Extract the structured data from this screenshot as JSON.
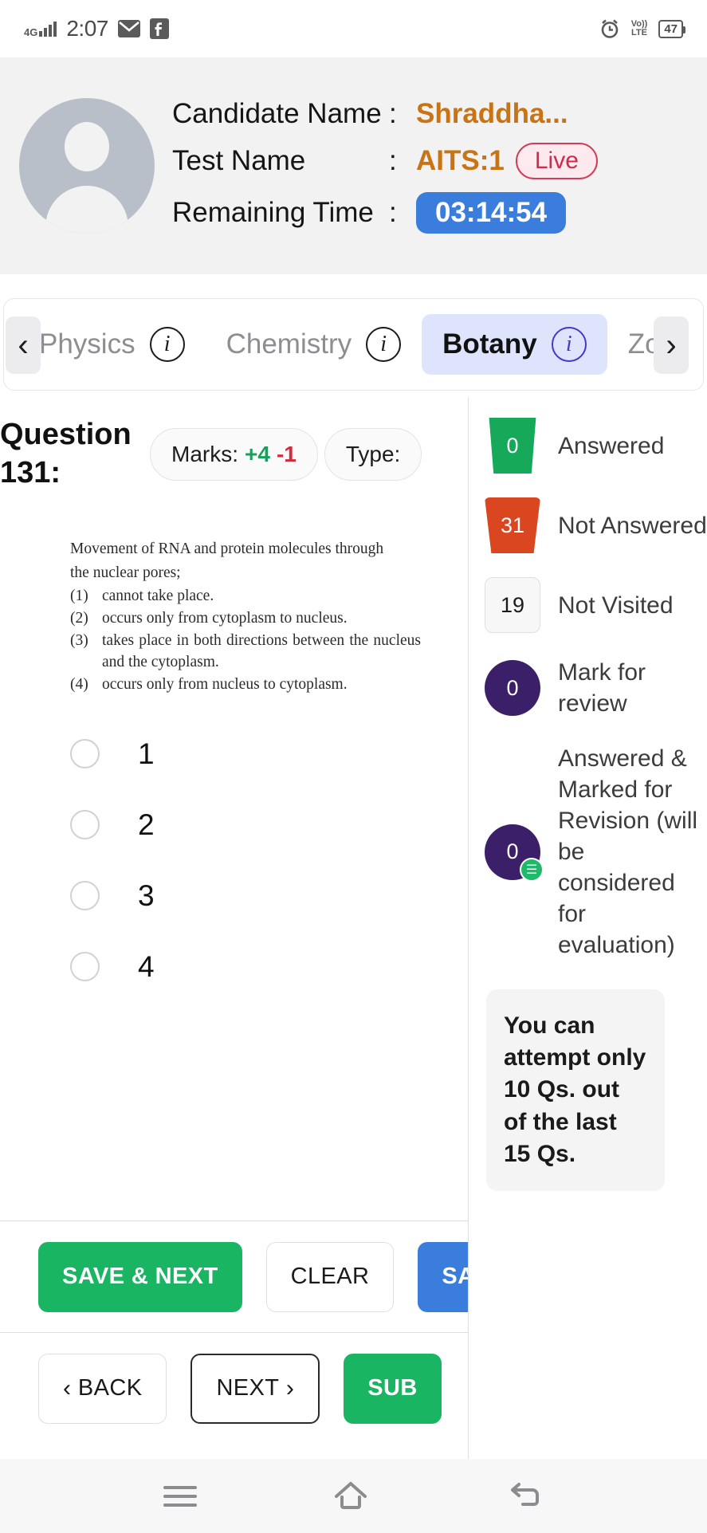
{
  "statusbar": {
    "network": "4G",
    "time": "2:07",
    "mail_icon": "mail-icon",
    "facebook_icon": "facebook-icon",
    "alarm_icon": "alarm-icon",
    "volte_line1": "Vo))",
    "volte_line2": "LTE",
    "battery": "47"
  },
  "header": {
    "rows": [
      {
        "label": "Candidate Name",
        "colon": ":",
        "value": "Shraddha..."
      },
      {
        "label": "Test Name",
        "colon": ":",
        "value": "AITS:1",
        "badge": "Live"
      },
      {
        "label": "Remaining Time",
        "colon": ":",
        "timer": "03:14:54"
      }
    ],
    "avatar": "user-avatar-placeholder",
    "accent_value": "#c87414",
    "live_color": "#d12a4b",
    "timer_bg": "#3b7ddd"
  },
  "tabs": {
    "left_arrow": "‹",
    "right_arrow": "›",
    "items": [
      {
        "label": "Physics",
        "info": "i",
        "active": false
      },
      {
        "label": "Chemistry",
        "info": "i",
        "active": false
      },
      {
        "label": "Botany",
        "info": "i",
        "active": true
      },
      {
        "label": "Zo",
        "info": "",
        "active": false
      }
    ],
    "active_bg": "#dde4fb"
  },
  "question": {
    "number_label": "Question 131:",
    "marks_chip_label": "Marks:",
    "marks_positive": "+4",
    "marks_negative": "-1",
    "type_chip_label": "Type:",
    "stem_line1": "Movement of RNA and protein molecules through",
    "stem_line2": "the nuclear pores;",
    "choices": [
      {
        "num": "(1)",
        "text": "cannot take place."
      },
      {
        "num": "(2)",
        "text": "occurs only from cytoplasm to nucleus."
      },
      {
        "num": "(3)",
        "text": "takes place in both directions between the nucleus and the cytoplasm."
      },
      {
        "num": "(4)",
        "text": "occurs only from nucleus to cytoplasm."
      }
    ],
    "options": [
      {
        "value": "1",
        "selected": false
      },
      {
        "value": "2",
        "selected": false
      },
      {
        "value": "3",
        "selected": false
      },
      {
        "value": "4",
        "selected": false
      }
    ]
  },
  "actions": {
    "save_next": "SAVE & NEXT",
    "clear": "CLEAR",
    "save_marked": "SA",
    "back": "BACK",
    "back_chevron": "‹",
    "next": "NEXT",
    "next_chevron": "›",
    "submit": "SUB"
  },
  "legend": {
    "items": [
      {
        "count": "0",
        "label": "Answered",
        "style": "answered"
      },
      {
        "count": "31",
        "label": "Not Answered",
        "style": "notans"
      },
      {
        "count": "19",
        "label": "Not Visited",
        "style": "notvis"
      },
      {
        "count": "0",
        "label": "Mark for review",
        "style": "review"
      },
      {
        "count": "0",
        "label": "Answered & Marked for Revision (will be considered for evaluation)",
        "style": "ansreview",
        "dot": "☰"
      }
    ],
    "note": "You can attempt only 10 Qs. out of the last 15 Qs."
  },
  "navbar": {
    "recents": "recents-icon",
    "home": "home-icon",
    "back": "back-icon"
  }
}
